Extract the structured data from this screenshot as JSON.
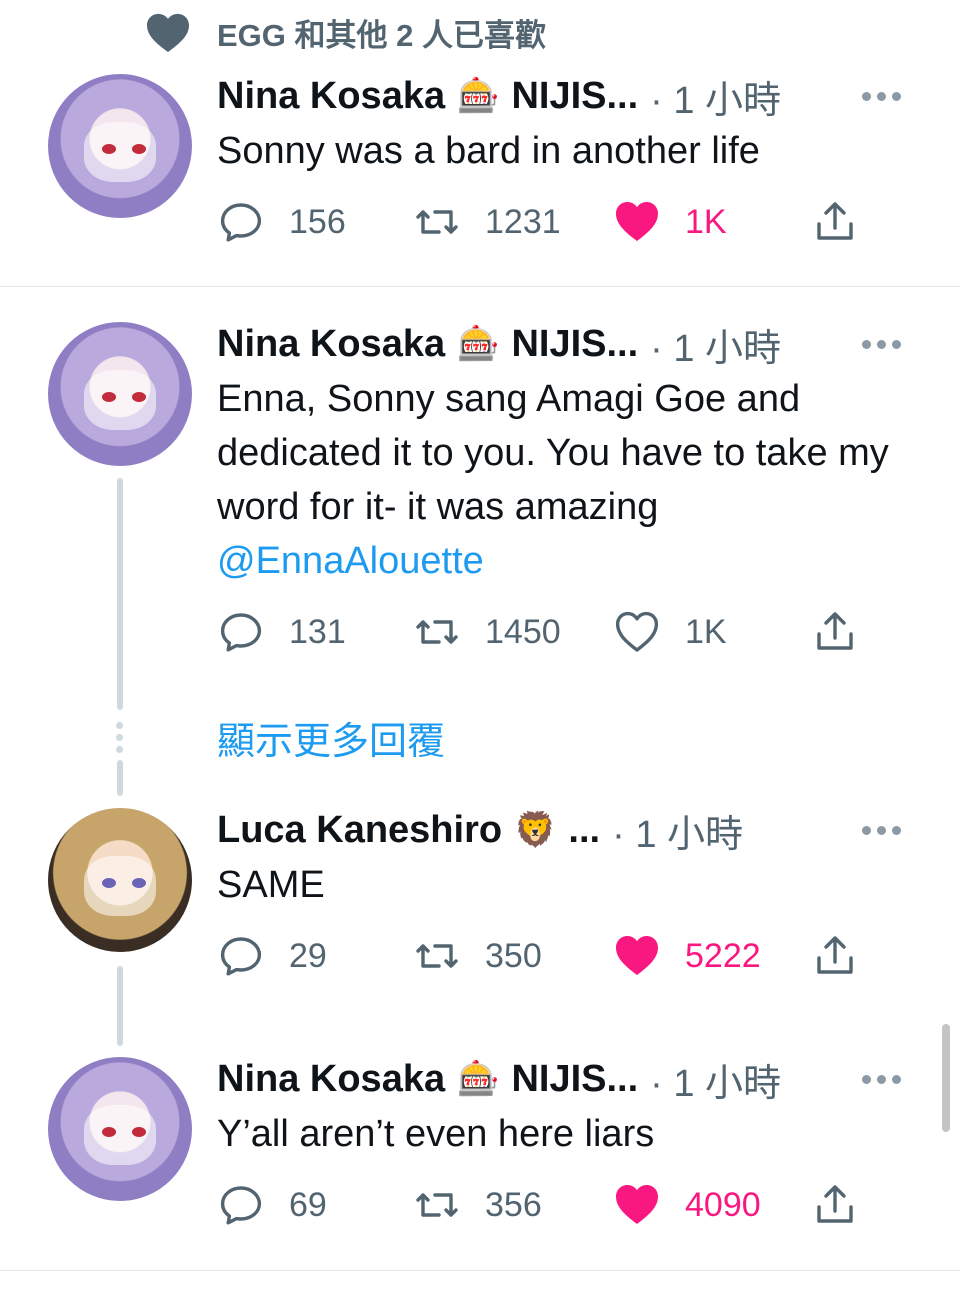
{
  "liked_by": {
    "text": "EGG 和其他 2 人已喜歡"
  },
  "tweets": [
    {
      "author": "Nina Kosaka",
      "badge": "🎰",
      "handle_trunc": "NIJIS...",
      "time": "· 1 小時",
      "text": "Sonny was a bard in another life",
      "reply_count": "156",
      "retweet_count": "1231",
      "like_count": "1K",
      "liked": true
    },
    {
      "author": "Nina Kosaka",
      "badge": "🎰",
      "handle_trunc": "NIJIS...",
      "time": "· 1 小時",
      "text": "Enna, Sonny sang Amagi Goe and dedicated it to you. You have to take my word for it- it was amazing",
      "mention": "@EnnaAlouette",
      "reply_count": "131",
      "retweet_count": "1450",
      "like_count": "1K",
      "liked": false
    },
    {
      "author": "Luca Kaneshiro",
      "badge": "🦁",
      "handle_trunc": "...",
      "time": "· 1 小時",
      "text": "SAME",
      "reply_count": "29",
      "retweet_count": "350",
      "like_count": "5222",
      "liked": true
    },
    {
      "author": "Nina Kosaka",
      "badge": "🎰",
      "handle_trunc": "NIJIS...",
      "time": "· 1 小時",
      "text": "Y’all aren’t even here  liars",
      "reply_count": "69",
      "retweet_count": "356",
      "like_count": "4090",
      "liked": true
    }
  ],
  "show_more_replies": "顯示更多回覆",
  "colors": {
    "like": "#f91880",
    "link": "#1d9bf0",
    "muted": "#536471"
  },
  "icons": [
    "heart-icon",
    "reply-icon",
    "retweet-icon",
    "share-icon",
    "more-icon"
  ]
}
